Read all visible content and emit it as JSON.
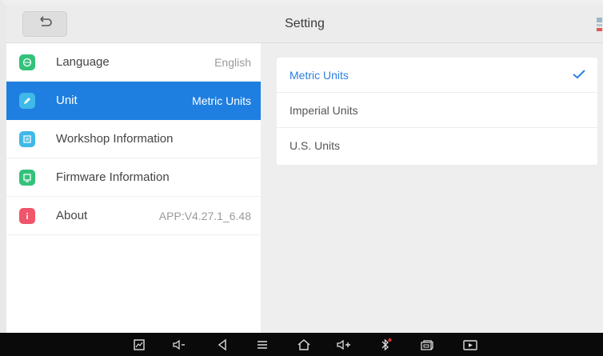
{
  "header": {
    "title": "Setting"
  },
  "menu": [
    {
      "label": "Language",
      "value": "English",
      "icon": "globe-icon",
      "color": "#33c27a"
    },
    {
      "label": "Unit",
      "value": "Metric Units",
      "icon": "edit-icon",
      "color": "#3fb9e8",
      "active": true
    },
    {
      "label": "Workshop Information",
      "value": "",
      "icon": "workshop-icon",
      "color": "#3fb9e8"
    },
    {
      "label": "Firmware Information",
      "value": "",
      "icon": "firmware-icon",
      "color": "#33c27a"
    },
    {
      "label": "About",
      "value": "APP:V4.27.1_6.48",
      "icon": "info-icon",
      "color": "#f0556a"
    }
  ],
  "unit_options": [
    {
      "label": "Metric Units",
      "selected": true
    },
    {
      "label": "Imperial Units",
      "selected": false
    },
    {
      "label": "U.S. Units",
      "selected": false
    }
  ],
  "colors": {
    "accent": "#1f7fe0",
    "selected_text": "#2b7fe0",
    "navbar": "#0a0a0a"
  },
  "navbar_icons": [
    "screenshot-icon",
    "volume-down-icon",
    "back-icon",
    "menu-icon",
    "home-icon",
    "volume-up-icon",
    "bluetooth-icon",
    "vci-icon",
    "screen-record-icon"
  ]
}
